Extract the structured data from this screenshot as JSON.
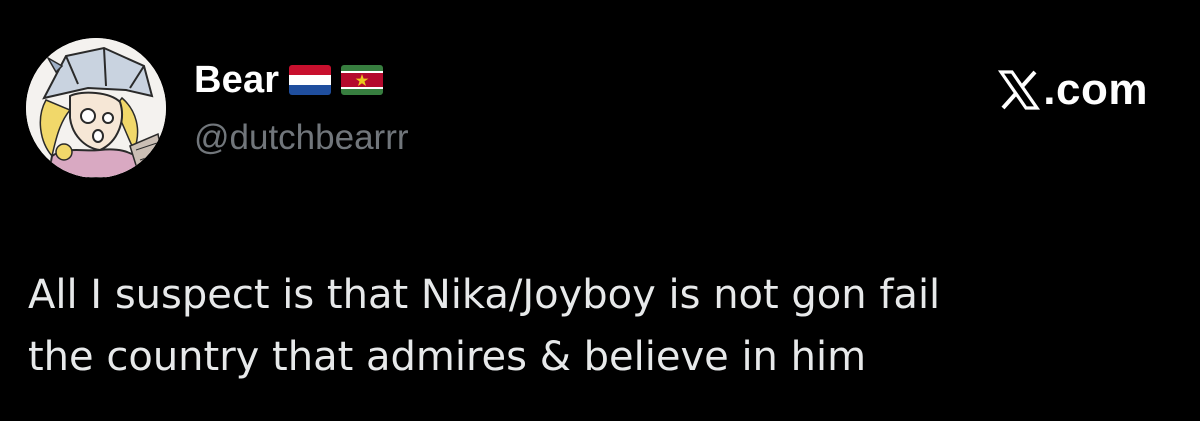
{
  "author": {
    "display_name": "Bear",
    "handle": "@dutchbearrr",
    "flags": [
      "netherlands-flag",
      "suriname-flag"
    ]
  },
  "brand": {
    "icon": "x-logo",
    "text": ".com"
  },
  "tweet": {
    "lines": [
      "All I suspect is that Nika/Joyboy is not gon fail",
      "the country that admires & believe in him"
    ]
  },
  "colors": {
    "background": "#000000",
    "name": "#ffffff",
    "handle": "#71767b",
    "body_text": "#e7e9ea"
  }
}
